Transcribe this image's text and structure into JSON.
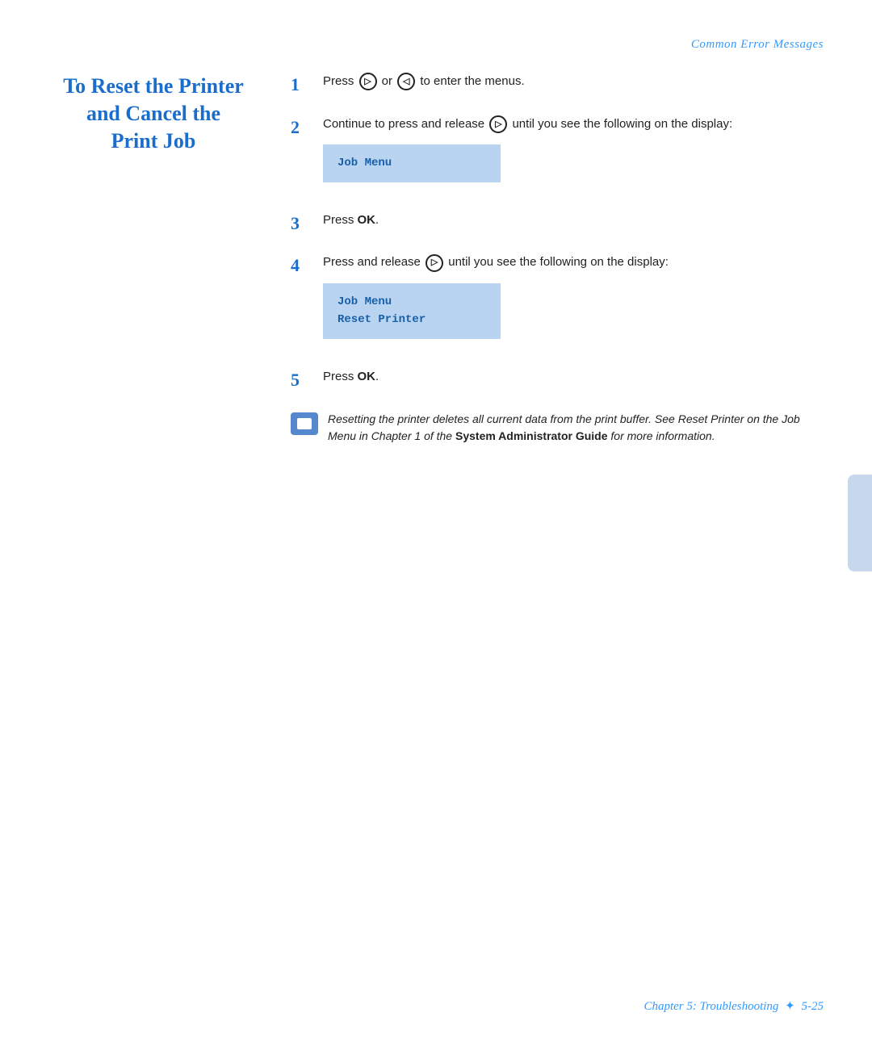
{
  "header": {
    "section_title": "Common Error Messages"
  },
  "left_heading": {
    "line1": "To Reset the Printer",
    "line2": "and Cancel the",
    "line3": "Print Job"
  },
  "steps": [
    {
      "number": "1",
      "text_parts": [
        "Press",
        " or ",
        " to enter the menus."
      ],
      "icons": [
        "circle-right",
        "circle-left"
      ]
    },
    {
      "number": "2",
      "text_parts": [
        "Continue to press and release",
        " until you see the following on the display:"
      ],
      "icons": [
        "circle-right"
      ],
      "display": [
        "Job Menu"
      ]
    },
    {
      "number": "3",
      "text_parts": [
        "Press ",
        "OK",
        "."
      ],
      "bold": [
        false,
        true,
        false
      ]
    },
    {
      "number": "4",
      "text_parts": [
        "Press and release",
        " until you see the following on the display:"
      ],
      "icons": [
        "circle-right"
      ],
      "display": [
        "Job Menu",
        "Reset Printer"
      ]
    },
    {
      "number": "5",
      "text_parts": [
        "Press ",
        "OK",
        "."
      ],
      "bold": [
        false,
        true,
        false
      ]
    }
  ],
  "note": {
    "text": "Resetting the printer deletes all current data from the print buffer. See Reset Printer on the Job Menu in Chapter 1 of the ",
    "bold_part": "System Administrator Guide",
    "text_after": " for more information."
  },
  "footer": {
    "chapter": "Chapter 5: Troubleshooting",
    "page": "5-25"
  }
}
